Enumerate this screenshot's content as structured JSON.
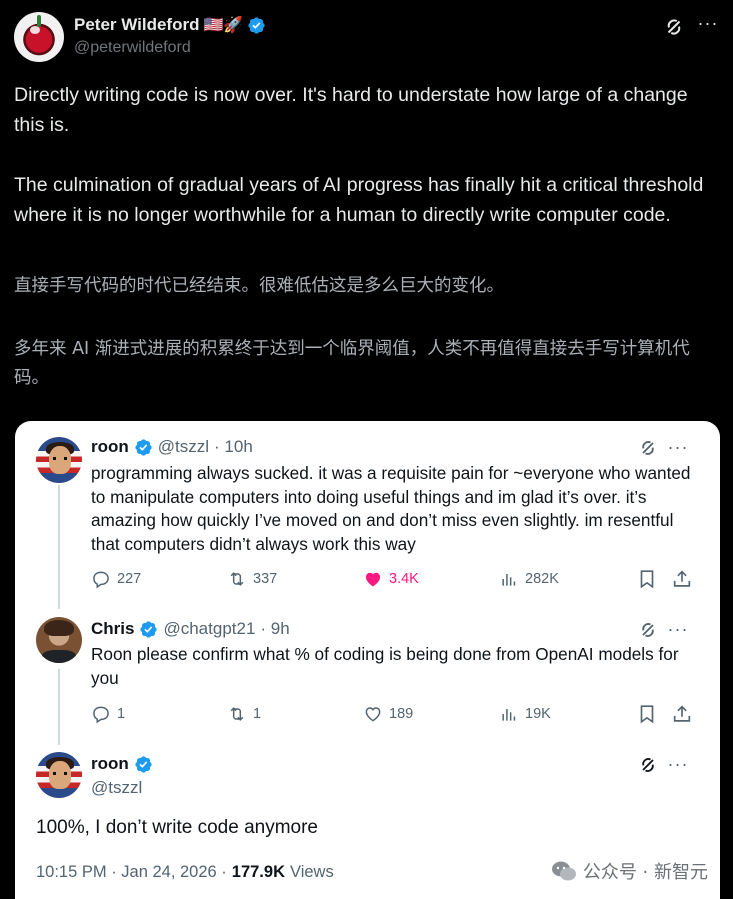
{
  "author": {
    "name": "Peter Wildeford",
    "emojis": "🇺🇸🚀",
    "handle": "@peterwildeford"
  },
  "post": {
    "paragraph1": "Directly writing code is now over. It's hard to understate how large of a change this is.",
    "paragraph2": "The culmination of gradual years of AI progress has finally hit a critical threshold where it is no longer worthwhile for a human to directly write computer code.",
    "translation1": "直接手写代码的时代已经结束。很难低估这是多么巨大的变化。",
    "translation2": "多年来 AI 渐进式进展的积累终于达到一个临界阈值，人类不再值得直接去手写计算机代码。"
  },
  "thread": [
    {
      "name": "roon",
      "handle": "@tszzl",
      "time": "· 10h",
      "body": "programming always sucked. it was a requisite pain for ~everyone who wanted to manipulate computers into doing useful things and im glad it’s over. it’s amazing how quickly I’ve moved on and don’t miss even slightly. im resentful that computers didn’t always work this way",
      "replies": "227",
      "reposts": "337",
      "likes": "3.4K",
      "views": "282K"
    },
    {
      "name": "Chris",
      "handle": "@chatgpt21",
      "time": "· 9h",
      "body": "Roon please confirm what % of coding is being done from OpenAI models for you",
      "replies": "1",
      "reposts": "1",
      "likes": "189",
      "views": "19K"
    }
  ],
  "final": {
    "name": "roon",
    "handle": "@tszzl",
    "body": "100%, I don’t write code anymore",
    "timestamp": "10:15 PM · Jan 24, 2026 ·",
    "views_count": "177.9K",
    "views_label": "Views"
  },
  "watermark": {
    "text": "公众号 · 新智元"
  },
  "colors": {
    "verified": "#1d9bf0",
    "like": "#f91880",
    "muted": "#536471"
  }
}
